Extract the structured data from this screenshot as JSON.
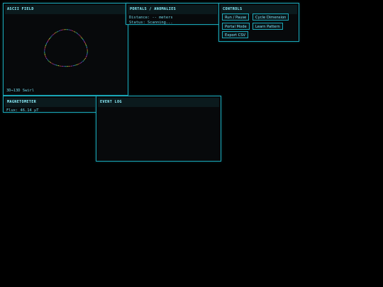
{
  "ascii": {
    "title": "ASCII FIELD",
    "mode_label": "3D→13D Swirl"
  },
  "portals": {
    "title": "PORTALS / ANOMALIES",
    "distance": "Distance: -- meters",
    "status": "Status: Scanning..."
  },
  "controls": {
    "title": "CONTROLS",
    "run_pause": "Run / Pause",
    "cycle_dimension": "Cycle Dimension",
    "portal_mode": "Portal Mode",
    "learn_pattern": "Learn Pattern",
    "export_csv": "Export CSV"
  },
  "magnetometer": {
    "title": "MAGNETOMETER",
    "flux": "Flux: 46.14 µT"
  },
  "event_log": {
    "title": "EVENT LOG",
    "entries": []
  },
  "colors": {
    "accent": "#1aa6b7",
    "text": "#7fe9ff",
    "background": "#000000"
  }
}
